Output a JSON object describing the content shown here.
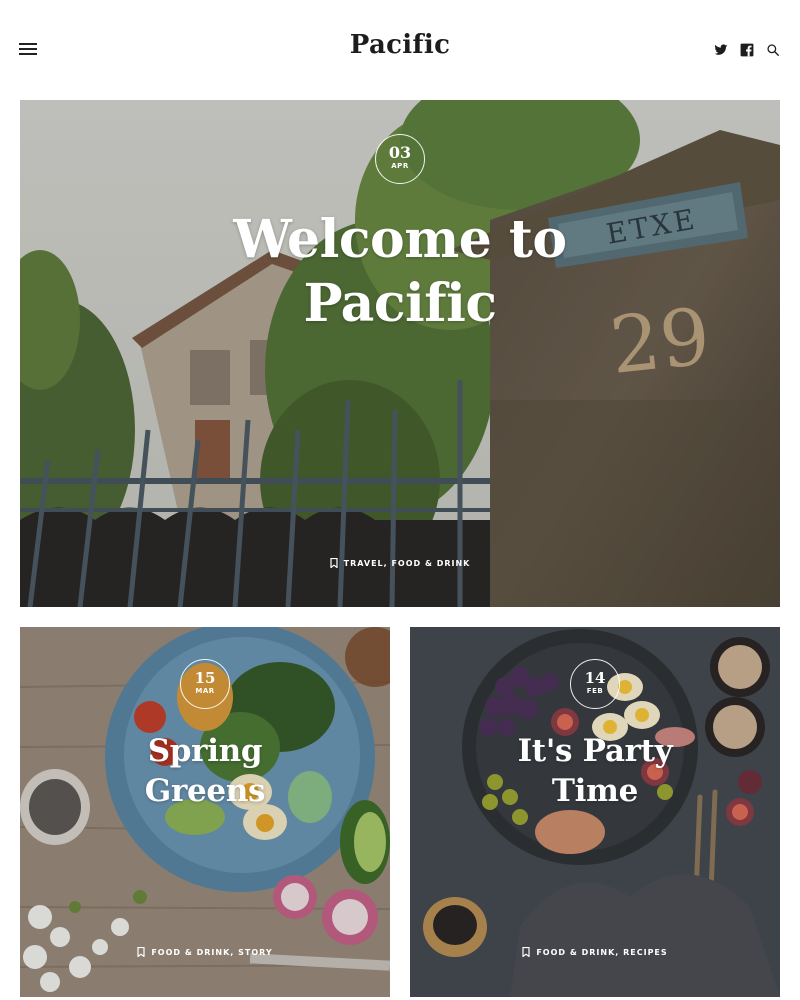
{
  "site": {
    "logo": "Pacific",
    "icons": [
      "menu-icon",
      "twitter-icon",
      "facebook-icon",
      "search-icon"
    ]
  },
  "hero": {
    "day": "03",
    "month": "APR",
    "title_line1": "Welcome to",
    "title_line2": "Pacific",
    "categories": "TRAVEL, FOOD & DRINK",
    "sign_text": "ETXE",
    "house_number": "29"
  },
  "posts": [
    {
      "day": "15",
      "month": "MAR",
      "title_line1": "Spring",
      "title_line2": "Greens",
      "categories": "FOOD & DRINK, STORY"
    },
    {
      "day": "14",
      "month": "FEB",
      "title_line1": "It's Party",
      "title_line2": "Time",
      "categories": "FOOD & DRINK, RECIPES"
    }
  ],
  "colors": {
    "text": "#1d1d1d",
    "overlay_text": "#ffffff"
  }
}
